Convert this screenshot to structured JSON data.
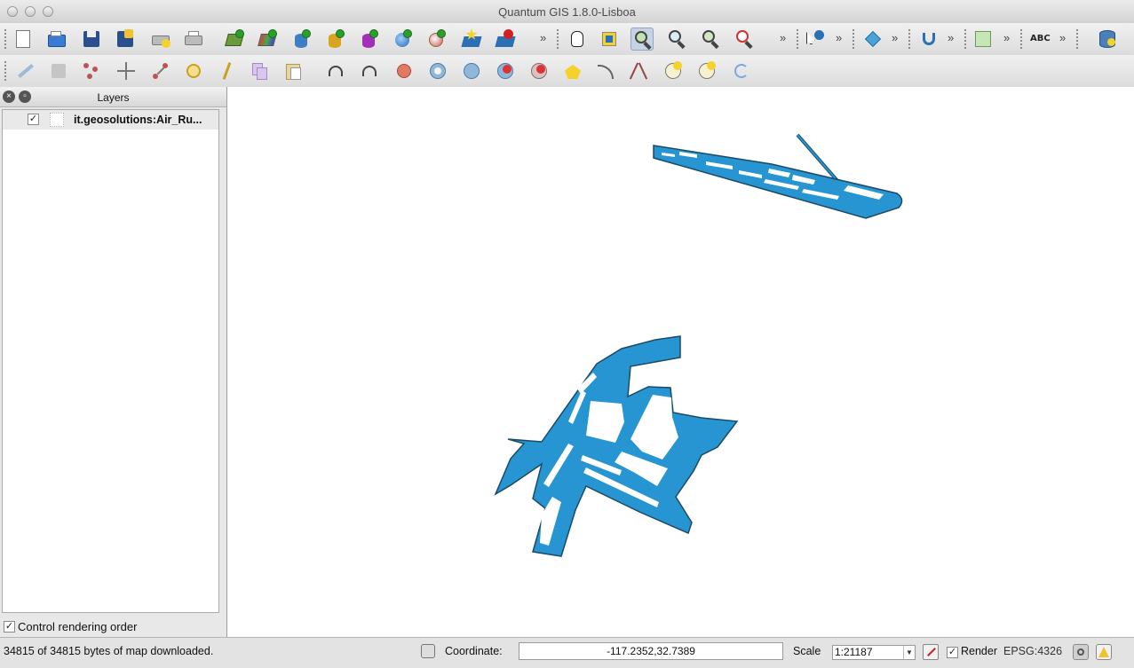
{
  "window": {
    "title": "Quantum GIS 1.8.0-Lisboa"
  },
  "toolbar1": {
    "icons": [
      "new-project-icon",
      "open-project-icon",
      "save-project-icon",
      "save-as-icon",
      "new-print-composer-icon",
      "print-composer-manager-icon",
      "add-vector-layer-icon",
      "add-raster-layer-icon",
      "add-postgis-layer-icon",
      "add-spatialite-layer-icon",
      "add-mssql-layer-icon",
      "add-wms-layer-icon",
      "add-wfs-layer-icon",
      "new-shapefile-icon",
      "remove-layer-icon",
      "pan-icon",
      "pan-to-selection-icon",
      "zoom-in-icon",
      "zoom-out-icon",
      "zoom-full-icon",
      "zoom-to-layer-icon",
      "identify-icon",
      "select-icon",
      "measure-icon",
      "label-icon",
      "database-icon"
    ],
    "more": "»"
  },
  "toolbar2": {
    "icons": [
      "toggle-editing-icon",
      "save-edits-icon",
      "add-feature-icon",
      "move-feature-icon",
      "node-tool-icon",
      "delete-selected-icon",
      "cut-features-icon",
      "copy-features-icon",
      "paste-features-icon",
      "undo-icon",
      "redo-icon",
      "simplify-feature-icon",
      "add-ring-icon",
      "add-part-icon",
      "delete-ring-icon",
      "delete-part-icon",
      "reshape-features-icon",
      "offset-curve-icon",
      "split-features-icon",
      "merge-features-icon",
      "merge-attributes-icon",
      "rotate-point-symbols-icon"
    ]
  },
  "layers_panel": {
    "title": "Layers",
    "layers": [
      {
        "name": "it.geosolutions:Air_Ru...",
        "checked": true
      }
    ],
    "control_rendering_order": {
      "label": "Control rendering order",
      "checked": true
    }
  },
  "map": {
    "fill_color": "#2795d1",
    "outline_color": "#1a4a66"
  },
  "statusbar": {
    "message": "34815 of 34815 bytes of map downloaded.",
    "coordinate_label": "Coordinate:",
    "coordinate_value": "-117.2352,32.7389",
    "scale_label": "Scale",
    "scale_value": "1:21187",
    "render_label": "Render",
    "render_checked": true,
    "crs": "EPSG:4326"
  }
}
